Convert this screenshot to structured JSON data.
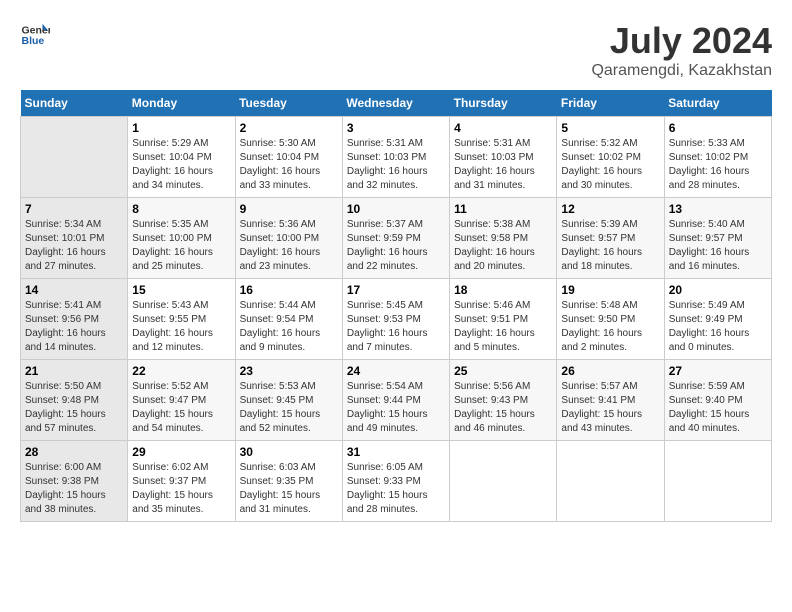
{
  "header": {
    "logo_general": "General",
    "logo_blue": "Blue",
    "title": "July 2024",
    "subtitle": "Qaramengdi, Kazakhstan"
  },
  "weekdays": [
    "Sunday",
    "Monday",
    "Tuesday",
    "Wednesday",
    "Thursday",
    "Friday",
    "Saturday"
  ],
  "weeks": [
    [
      {
        "day": "",
        "info": ""
      },
      {
        "day": "1",
        "info": "Sunrise: 5:29 AM\nSunset: 10:04 PM\nDaylight: 16 hours\nand 34 minutes."
      },
      {
        "day": "2",
        "info": "Sunrise: 5:30 AM\nSunset: 10:04 PM\nDaylight: 16 hours\nand 33 minutes."
      },
      {
        "day": "3",
        "info": "Sunrise: 5:31 AM\nSunset: 10:03 PM\nDaylight: 16 hours\nand 32 minutes."
      },
      {
        "day": "4",
        "info": "Sunrise: 5:31 AM\nSunset: 10:03 PM\nDaylight: 16 hours\nand 31 minutes."
      },
      {
        "day": "5",
        "info": "Sunrise: 5:32 AM\nSunset: 10:02 PM\nDaylight: 16 hours\nand 30 minutes."
      },
      {
        "day": "6",
        "info": "Sunrise: 5:33 AM\nSunset: 10:02 PM\nDaylight: 16 hours\nand 28 minutes."
      }
    ],
    [
      {
        "day": "7",
        "info": "Sunrise: 5:34 AM\nSunset: 10:01 PM\nDaylight: 16 hours\nand 27 minutes."
      },
      {
        "day": "8",
        "info": "Sunrise: 5:35 AM\nSunset: 10:00 PM\nDaylight: 16 hours\nand 25 minutes."
      },
      {
        "day": "9",
        "info": "Sunrise: 5:36 AM\nSunset: 10:00 PM\nDaylight: 16 hours\nand 23 minutes."
      },
      {
        "day": "10",
        "info": "Sunrise: 5:37 AM\nSunset: 9:59 PM\nDaylight: 16 hours\nand 22 minutes."
      },
      {
        "day": "11",
        "info": "Sunrise: 5:38 AM\nSunset: 9:58 PM\nDaylight: 16 hours\nand 20 minutes."
      },
      {
        "day": "12",
        "info": "Sunrise: 5:39 AM\nSunset: 9:57 PM\nDaylight: 16 hours\nand 18 minutes."
      },
      {
        "day": "13",
        "info": "Sunrise: 5:40 AM\nSunset: 9:57 PM\nDaylight: 16 hours\nand 16 minutes."
      }
    ],
    [
      {
        "day": "14",
        "info": "Sunrise: 5:41 AM\nSunset: 9:56 PM\nDaylight: 16 hours\nand 14 minutes."
      },
      {
        "day": "15",
        "info": "Sunrise: 5:43 AM\nSunset: 9:55 PM\nDaylight: 16 hours\nand 12 minutes."
      },
      {
        "day": "16",
        "info": "Sunrise: 5:44 AM\nSunset: 9:54 PM\nDaylight: 16 hours\nand 9 minutes."
      },
      {
        "day": "17",
        "info": "Sunrise: 5:45 AM\nSunset: 9:53 PM\nDaylight: 16 hours\nand 7 minutes."
      },
      {
        "day": "18",
        "info": "Sunrise: 5:46 AM\nSunset: 9:51 PM\nDaylight: 16 hours\nand 5 minutes."
      },
      {
        "day": "19",
        "info": "Sunrise: 5:48 AM\nSunset: 9:50 PM\nDaylight: 16 hours\nand 2 minutes."
      },
      {
        "day": "20",
        "info": "Sunrise: 5:49 AM\nSunset: 9:49 PM\nDaylight: 16 hours\nand 0 minutes."
      }
    ],
    [
      {
        "day": "21",
        "info": "Sunrise: 5:50 AM\nSunset: 9:48 PM\nDaylight: 15 hours\nand 57 minutes."
      },
      {
        "day": "22",
        "info": "Sunrise: 5:52 AM\nSunset: 9:47 PM\nDaylight: 15 hours\nand 54 minutes."
      },
      {
        "day": "23",
        "info": "Sunrise: 5:53 AM\nSunset: 9:45 PM\nDaylight: 15 hours\nand 52 minutes."
      },
      {
        "day": "24",
        "info": "Sunrise: 5:54 AM\nSunset: 9:44 PM\nDaylight: 15 hours\nand 49 minutes."
      },
      {
        "day": "25",
        "info": "Sunrise: 5:56 AM\nSunset: 9:43 PM\nDaylight: 15 hours\nand 46 minutes."
      },
      {
        "day": "26",
        "info": "Sunrise: 5:57 AM\nSunset: 9:41 PM\nDaylight: 15 hours\nand 43 minutes."
      },
      {
        "day": "27",
        "info": "Sunrise: 5:59 AM\nSunset: 9:40 PM\nDaylight: 15 hours\nand 40 minutes."
      }
    ],
    [
      {
        "day": "28",
        "info": "Sunrise: 6:00 AM\nSunset: 9:38 PM\nDaylight: 15 hours\nand 38 minutes."
      },
      {
        "day": "29",
        "info": "Sunrise: 6:02 AM\nSunset: 9:37 PM\nDaylight: 15 hours\nand 35 minutes."
      },
      {
        "day": "30",
        "info": "Sunrise: 6:03 AM\nSunset: 9:35 PM\nDaylight: 15 hours\nand 31 minutes."
      },
      {
        "day": "31",
        "info": "Sunrise: 6:05 AM\nSunset: 9:33 PM\nDaylight: 15 hours\nand 28 minutes."
      },
      {
        "day": "",
        "info": ""
      },
      {
        "day": "",
        "info": ""
      },
      {
        "day": "",
        "info": ""
      }
    ]
  ]
}
